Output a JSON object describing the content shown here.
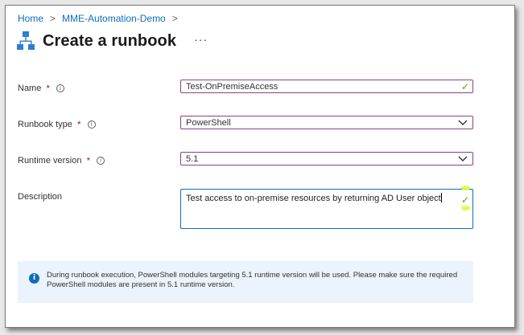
{
  "breadcrumb": {
    "items": [
      "Home",
      "MME-Automation-Demo"
    ],
    "separator": ">"
  },
  "header": {
    "title": "Create a runbook",
    "more": "···",
    "icon": "runbook-icon"
  },
  "form": {
    "name": {
      "label": "Name",
      "required_mark": "*",
      "value": "Test-OnPremiseAccess",
      "valid_icon": "✓"
    },
    "runbook_type": {
      "label": "Runbook type",
      "required_mark": "*",
      "value": "PowerShell"
    },
    "runtime_version": {
      "label": "Runtime version",
      "required_mark": "*",
      "value": "5.1"
    },
    "description": {
      "label": "Description",
      "value": "Test access to on-premise resources by returning AD User object",
      "valid_icon": "✓"
    }
  },
  "info_bar": {
    "text": "During runbook execution, PowerShell modules targeting 5.1 runtime version will be used. Please make sure the required PowerShell modules are present in 5.1 runtime version."
  },
  "colors": {
    "link": "#0f6cbd",
    "focus_border": "#8a3f8c",
    "valid": "#57a300",
    "required": "#a4262c",
    "info_bg": "#ebf3fc"
  }
}
